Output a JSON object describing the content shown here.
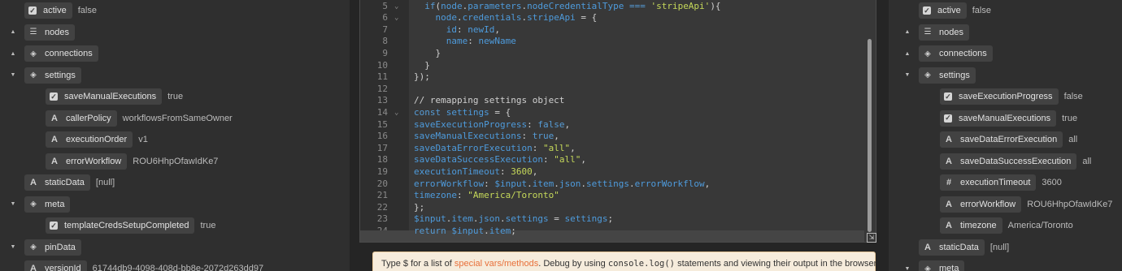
{
  "left_tree": [
    {
      "indent": 0,
      "chevron": "",
      "icon": "check",
      "label": "active",
      "value": "false"
    },
    {
      "indent": 0,
      "chevron": "up",
      "icon": "list",
      "label": "nodes",
      "value": ""
    },
    {
      "indent": 0,
      "chevron": "up",
      "icon": "cube",
      "label": "connections",
      "value": ""
    },
    {
      "indent": 0,
      "chevron": "down",
      "icon": "cube",
      "label": "settings",
      "value": ""
    },
    {
      "indent": 1,
      "chevron": "",
      "icon": "check",
      "label": "saveManualExecutions",
      "value": "true"
    },
    {
      "indent": 1,
      "chevron": "",
      "icon": "text",
      "label": "callerPolicy",
      "value": "workflowsFromSameOwner"
    },
    {
      "indent": 1,
      "chevron": "",
      "icon": "text",
      "label": "executionOrder",
      "value": "v1"
    },
    {
      "indent": 1,
      "chevron": "",
      "icon": "text",
      "label": "errorWorkflow",
      "value": "ROU6HhpOfawIdKe7"
    },
    {
      "indent": 0,
      "chevron": "",
      "icon": "text",
      "label": "staticData",
      "value": "[null]"
    },
    {
      "indent": 0,
      "chevron": "down",
      "icon": "cube",
      "label": "meta",
      "value": ""
    },
    {
      "indent": 1,
      "chevron": "",
      "icon": "check",
      "label": "templateCredsSetupCompleted",
      "value": "true"
    },
    {
      "indent": 0,
      "chevron": "down",
      "icon": "cube",
      "label": "pinData",
      "value": ""
    },
    {
      "indent": 0,
      "chevron": "",
      "icon": "text",
      "label": "versionId",
      "value": "61744db9-4098-408d-bb8e-2072d263dd97"
    }
  ],
  "right_tree": [
    {
      "indent": 0,
      "chevron": "",
      "icon": "check",
      "label": "active",
      "value": "false"
    },
    {
      "indent": 0,
      "chevron": "up",
      "icon": "list",
      "label": "nodes",
      "value": ""
    },
    {
      "indent": 0,
      "chevron": "up",
      "icon": "cube",
      "label": "connections",
      "value": ""
    },
    {
      "indent": 0,
      "chevron": "down",
      "icon": "cube",
      "label": "settings",
      "value": ""
    },
    {
      "indent": 1,
      "chevron": "",
      "icon": "check",
      "label": "saveExecutionProgress",
      "value": "false"
    },
    {
      "indent": 1,
      "chevron": "",
      "icon": "check",
      "label": "saveManualExecutions",
      "value": "true"
    },
    {
      "indent": 1,
      "chevron": "",
      "icon": "text",
      "label": "saveDataErrorExecution",
      "value": "all"
    },
    {
      "indent": 1,
      "chevron": "",
      "icon": "text",
      "label": "saveDataSuccessExecution",
      "value": "all"
    },
    {
      "indent": 1,
      "chevron": "",
      "icon": "hash",
      "label": "executionTimeout",
      "value": "3600"
    },
    {
      "indent": 1,
      "chevron": "",
      "icon": "text",
      "label": "errorWorkflow",
      "value": "ROU6HhpOfawIdKe7"
    },
    {
      "indent": 1,
      "chevron": "",
      "icon": "text",
      "label": "timezone",
      "value": "America/Toronto"
    },
    {
      "indent": 0,
      "chevron": "",
      "icon": "text",
      "label": "staticData",
      "value": "[null]"
    },
    {
      "indent": 0,
      "chevron": "down",
      "icon": "cube",
      "label": "meta",
      "value": ""
    }
  ],
  "code_lines": [
    {
      "n": "5",
      "fold": "⌄",
      "tokens": [
        [
          "op",
          "  "
        ],
        [
          "kw",
          "if"
        ],
        [
          "op",
          "("
        ],
        [
          "pr",
          "node"
        ],
        [
          "op",
          "."
        ],
        [
          "pr",
          "parameters"
        ],
        [
          "op",
          "."
        ],
        [
          "pr",
          "nodeCredentialType"
        ],
        [
          "op",
          " "
        ],
        [
          "kw",
          "==="
        ],
        [
          "op",
          " "
        ],
        [
          "st",
          "'stripeApi'"
        ],
        [
          "op",
          "){"
        ]
      ]
    },
    {
      "n": "6",
      "fold": "⌄",
      "tokens": [
        [
          "op",
          "    "
        ],
        [
          "pr",
          "node"
        ],
        [
          "op",
          "."
        ],
        [
          "pr",
          "credentials"
        ],
        [
          "op",
          "."
        ],
        [
          "pr",
          "stripeApi"
        ],
        [
          "op",
          " = {"
        ]
      ]
    },
    {
      "n": "7",
      "fold": "",
      "tokens": [
        [
          "op",
          "      "
        ],
        [
          "pr",
          "id"
        ],
        [
          "op",
          ": "
        ],
        [
          "pr",
          "newId"
        ],
        [
          "op",
          ","
        ]
      ]
    },
    {
      "n": "8",
      "fold": "",
      "tokens": [
        [
          "op",
          "      "
        ],
        [
          "pr",
          "name"
        ],
        [
          "op",
          ": "
        ],
        [
          "pr",
          "newName"
        ]
      ]
    },
    {
      "n": "9",
      "fold": "",
      "tokens": [
        [
          "op",
          "    }"
        ]
      ]
    },
    {
      "n": "10",
      "fold": "",
      "tokens": [
        [
          "op",
          "  }"
        ]
      ]
    },
    {
      "n": "11",
      "fold": "",
      "tokens": [
        [
          "op",
          "});"
        ]
      ]
    },
    {
      "n": "12",
      "fold": "",
      "tokens": []
    },
    {
      "n": "13",
      "fold": "",
      "tokens": [
        [
          "op",
          "// remapping settings object"
        ]
      ]
    },
    {
      "n": "14",
      "fold": "⌄",
      "tokens": [
        [
          "kw",
          "const"
        ],
        [
          "op",
          " "
        ],
        [
          "pr",
          "settings"
        ],
        [
          "op",
          " = {"
        ]
      ]
    },
    {
      "n": "15",
      "fold": "",
      "tokens": [
        [
          "pr",
          "saveExecutionProgress"
        ],
        [
          "op",
          ": "
        ],
        [
          "kw",
          "false"
        ],
        [
          "op",
          ","
        ]
      ]
    },
    {
      "n": "16",
      "fold": "",
      "tokens": [
        [
          "pr",
          "saveManualExecutions"
        ],
        [
          "op",
          ": "
        ],
        [
          "kw",
          "true"
        ],
        [
          "op",
          ","
        ]
      ]
    },
    {
      "n": "17",
      "fold": "",
      "tokens": [
        [
          "pr",
          "saveDataErrorExecution"
        ],
        [
          "op",
          ": "
        ],
        [
          "st",
          "\"all\""
        ],
        [
          "op",
          ","
        ]
      ]
    },
    {
      "n": "18",
      "fold": "",
      "tokens": [
        [
          "pr",
          "saveDataSuccessExecution"
        ],
        [
          "op",
          ": "
        ],
        [
          "st",
          "\"all\""
        ],
        [
          "op",
          ","
        ]
      ]
    },
    {
      "n": "19",
      "fold": "",
      "tokens": [
        [
          "pr",
          "executionTimeout"
        ],
        [
          "op",
          ": "
        ],
        [
          "nu",
          "3600"
        ],
        [
          "op",
          ","
        ]
      ]
    },
    {
      "n": "20",
      "fold": "",
      "tokens": [
        [
          "pr",
          "errorWorkflow"
        ],
        [
          "op",
          ": "
        ],
        [
          "pr",
          "$input"
        ],
        [
          "op",
          "."
        ],
        [
          "pr",
          "item"
        ],
        [
          "op",
          "."
        ],
        [
          "pr",
          "json"
        ],
        [
          "op",
          "."
        ],
        [
          "pr",
          "settings"
        ],
        [
          "op",
          "."
        ],
        [
          "pr",
          "errorWorkflow"
        ],
        [
          "op",
          ","
        ]
      ]
    },
    {
      "n": "21",
      "fold": "",
      "tokens": [
        [
          "pr",
          "timezone"
        ],
        [
          "op",
          ": "
        ],
        [
          "st",
          "\"America/Toronto\""
        ]
      ]
    },
    {
      "n": "22",
      "fold": "",
      "tokens": [
        [
          "op",
          "};"
        ]
      ]
    },
    {
      "n": "23",
      "fold": "",
      "tokens": [
        [
          "pr",
          "$input"
        ],
        [
          "op",
          "."
        ],
        [
          "pr",
          "item"
        ],
        [
          "op",
          "."
        ],
        [
          "pr",
          "json"
        ],
        [
          "op",
          "."
        ],
        [
          "pr",
          "settings"
        ],
        [
          "op",
          " = "
        ],
        [
          "pr",
          "settings"
        ],
        [
          "op",
          ";"
        ]
      ]
    },
    {
      "n": "24",
      "fold": "",
      "tokens": [
        [
          "kw",
          "return"
        ],
        [
          "op",
          " "
        ],
        [
          "pr",
          "$input"
        ],
        [
          "op",
          "."
        ],
        [
          "pr",
          "item"
        ],
        [
          "op",
          ";"
        ]
      ]
    }
  ],
  "hint": {
    "part1": "Type $ for a list of ",
    "link": "special vars/methods",
    "part2": ". Debug by using ",
    "code": "console.log()",
    "part3": " statements and viewing their output in the browser"
  },
  "colors": {
    "keyword": "#569cd6",
    "property": "#4e9bdc",
    "string": "#c5d85a",
    "hint_link": "#e8703a"
  },
  "icons": {
    "check": "checkbox-icon",
    "list": "list-icon",
    "cube": "object-icon",
    "text": "text-type-icon",
    "hash": "number-type-icon"
  }
}
